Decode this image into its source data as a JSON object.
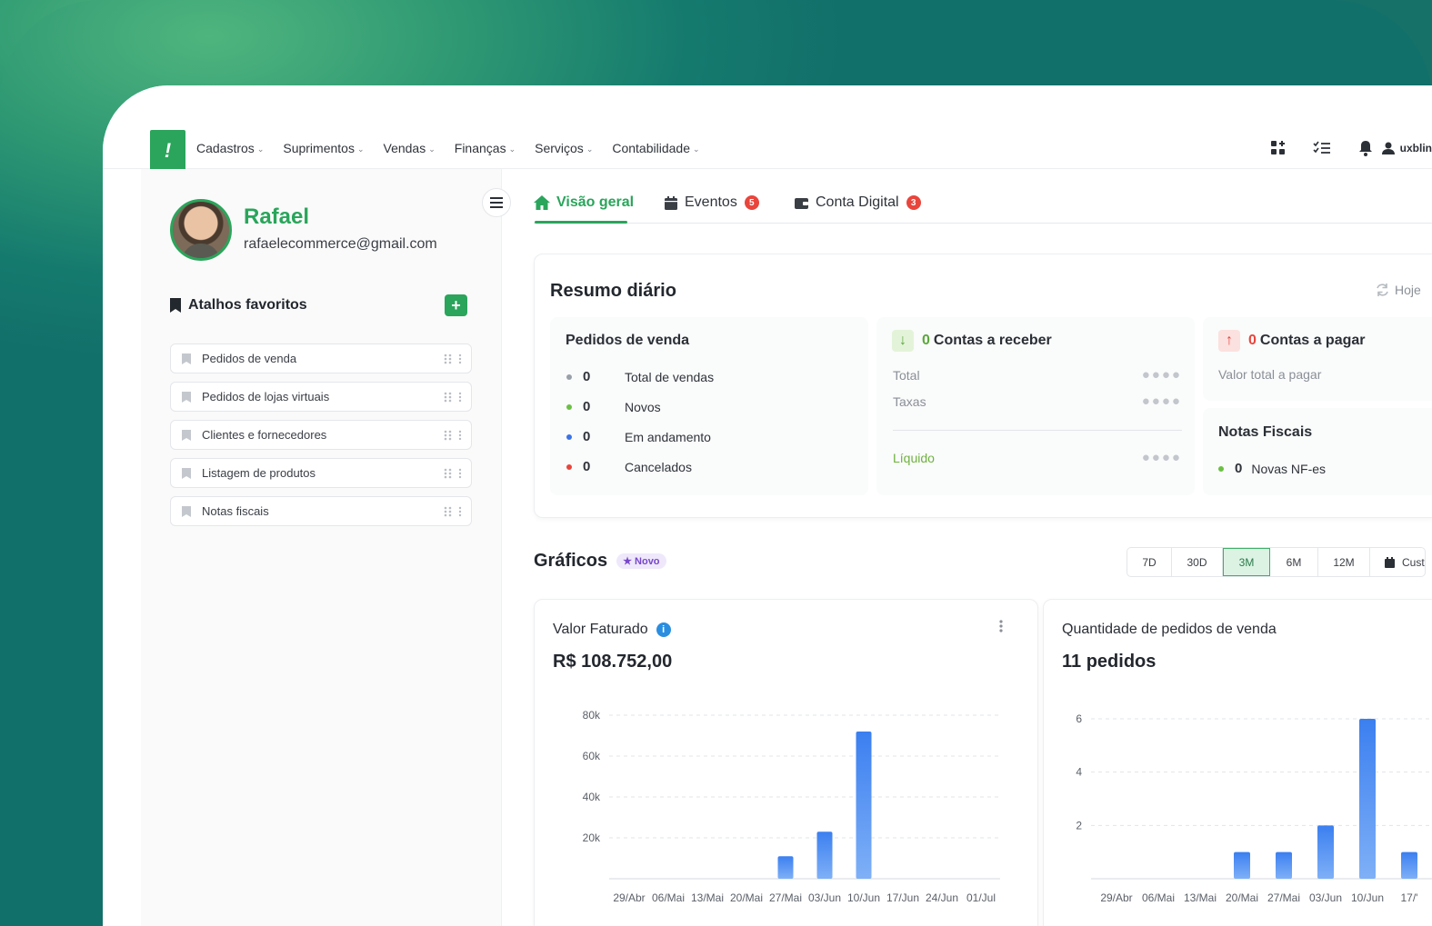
{
  "colors": {
    "brand": "#2aa55b",
    "bar_top": "#3b7ff0",
    "bar_bottom": "#7fb0f7",
    "danger": "#e8453c"
  },
  "nav": {
    "logo_glyph": "!",
    "menu": [
      {
        "label": "Cadastros"
      },
      {
        "label": "Suprimentos"
      },
      {
        "label": "Vendas"
      },
      {
        "label": "Finanças"
      },
      {
        "label": "Serviços"
      },
      {
        "label": "Contabilidade"
      }
    ],
    "icons": [
      "apps-add-icon",
      "checklist-icon",
      "bell-icon"
    ],
    "user_label": "uxblin"
  },
  "profile": {
    "name": "Rafael",
    "email": "rafaelecommerce@gmail.com"
  },
  "favorites": {
    "title": "Atalhos favoritos",
    "add_label": "+",
    "items": [
      {
        "label": "Pedidos de venda"
      },
      {
        "label": "Pedidos de lojas virtuais"
      },
      {
        "label": "Clientes e fornecedores"
      },
      {
        "label": "Listagem de produtos"
      },
      {
        "label": "Notas fiscais"
      }
    ]
  },
  "tabs": [
    {
      "label": "Visão geral",
      "active": true,
      "badge": ""
    },
    {
      "label": "Eventos",
      "badge": "5"
    },
    {
      "label": "Conta Digital",
      "badge": "3"
    }
  ],
  "resumo": {
    "title": "Resumo diário",
    "period": "Hoje",
    "pedidos": {
      "title": "Pedidos de venda",
      "rows": [
        {
          "value": "0",
          "label": "Total de vendas",
          "color": "#9aa0a8"
        },
        {
          "value": "0",
          "label": "Novos",
          "color": "#6ac043"
        },
        {
          "value": "0",
          "label": "Em andamento",
          "color": "#3b73e6"
        },
        {
          "value": "0",
          "label": "Cancelados",
          "color": "#e8453c"
        }
      ]
    },
    "receber": {
      "count": "0",
      "title": "Contas a receber",
      "rows": [
        {
          "label": "Total",
          "value": "●●●●"
        },
        {
          "label": "Taxas",
          "value": "●●●●"
        }
      ],
      "net_label": "Líquido",
      "net_value": "●●●●"
    },
    "pagar": {
      "count": "0",
      "title": "Contas a pagar",
      "total_label": "Valor total a pagar"
    },
    "notas": {
      "title": "Notas Fiscais",
      "count": "0",
      "label": "Novas NF-es"
    }
  },
  "graficos": {
    "title": "Gráficos",
    "badge": "Novo",
    "ranges": [
      "7D",
      "30D",
      "3M",
      "6M",
      "12M",
      "Cust"
    ],
    "active_range": "3M"
  },
  "chart_data": [
    {
      "type": "bar",
      "title": "Valor Faturado",
      "summary": "R$ 108.752,00",
      "categories": [
        "29/Abr",
        "06/Mai",
        "13/Mai",
        "20/Mai",
        "27/Mai",
        "03/Jun",
        "10/Jun",
        "17/Jun",
        "24/Jun",
        "01/Jul"
      ],
      "values": [
        0,
        0,
        0,
        0,
        11000,
        23000,
        72000,
        0,
        0,
        0
      ],
      "ylim": [
        0,
        80000
      ],
      "yticks": [
        "20k",
        "40k",
        "60k",
        "80k"
      ],
      "ytick_values": [
        20000,
        40000,
        60000,
        80000
      ],
      "grid": true
    },
    {
      "type": "bar",
      "title": "Quantidade de pedidos de venda",
      "summary": "11 pedidos",
      "categories": [
        "29/Abr",
        "06/Mai",
        "13/Mai",
        "20/Mai",
        "27/Mai",
        "03/Jun",
        "10/Jun",
        "17/'"
      ],
      "values": [
        0,
        0,
        0,
        1,
        1,
        2,
        6,
        1
      ],
      "ylim": [
        0,
        6
      ],
      "yticks": [
        "2",
        "4",
        "6"
      ],
      "ytick_values": [
        2,
        4,
        6
      ],
      "grid": true
    }
  ]
}
